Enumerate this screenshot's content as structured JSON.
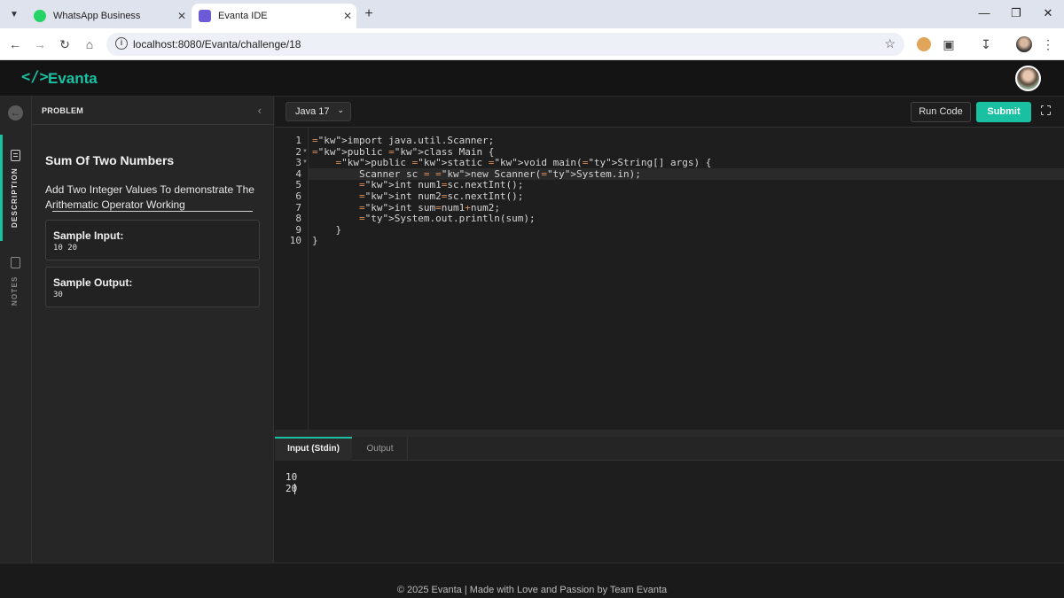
{
  "browser": {
    "tabs": [
      {
        "title": "WhatsApp Business",
        "active": false
      },
      {
        "title": "Evanta IDE",
        "active": true
      }
    ],
    "url": "localhost:8080/Evanta/challenge/18"
  },
  "app": {
    "logo_mark": "</>",
    "name": "Evanta"
  },
  "rail": {
    "items": [
      {
        "label": "DESCRIPTION",
        "icon": "document-icon",
        "active": true
      },
      {
        "label": "NOTES",
        "icon": "notes-icon",
        "active": false
      }
    ]
  },
  "problem": {
    "header": "PROBLEM",
    "title": "Sum Of Two Numbers",
    "description": "Add Two Integer Values To demonstrate The Arithematic Operator Working",
    "sample_input_label": "Sample Input:",
    "sample_input_value": "10 20",
    "sample_output_label": "Sample Output:",
    "sample_output_value": "30"
  },
  "editor": {
    "language": "Java 17",
    "run_label": "Run Code",
    "submit_label": "Submit",
    "line_numbers": [
      "1",
      "2",
      "3",
      "4",
      "5",
      "6",
      "7",
      "8",
      "9",
      "10"
    ],
    "active_line": 4,
    "code_lines": [
      "import java.util.Scanner;",
      "public class Main {",
      "    public static void main(String[] args) {",
      "        Scanner sc = new Scanner(System.in);",
      "        int num1=sc.nextInt();",
      "        int num2=sc.nextInt();",
      "        int sum=num1+num2;",
      "        System.out.println(sum);",
      "    }",
      "}"
    ]
  },
  "io": {
    "input_tab": "Input (Stdin)",
    "output_tab": "Output",
    "stdin_value": "10 20"
  },
  "footer": {
    "text": "© 2025 Evanta | Made with Love and Passion by Team Evanta"
  },
  "colors": {
    "accent": "#19c1a2",
    "background": "#1e1e1e",
    "panel": "#262626"
  }
}
